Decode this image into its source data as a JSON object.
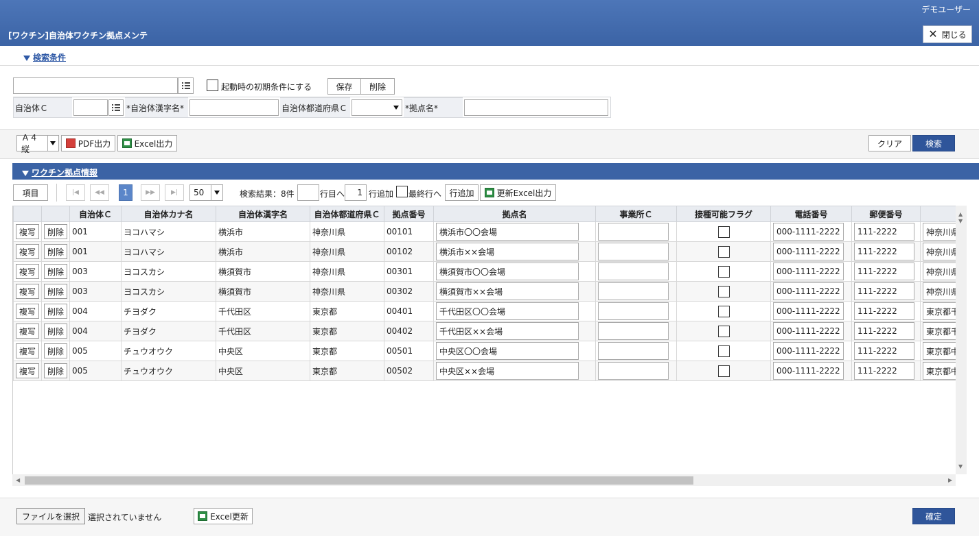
{
  "header": {
    "user": "デモユーザー",
    "title": "[ワクチン]自治体ワクチン拠点メンテ",
    "close_label": "閉じる"
  },
  "search": {
    "section_title": "検索条件",
    "saved_condition_value": "",
    "startup_checkbox_label": "起動時の初期条件にする",
    "save_label": "保存",
    "delete_label": "削除",
    "fields": [
      {
        "label": "自治体Ｃ",
        "value": ""
      },
      {
        "label": "*自治体漢字名*",
        "value": ""
      },
      {
        "label": "自治体都道府県Ｃ",
        "value": ""
      },
      {
        "label": "*拠点名*",
        "value": ""
      }
    ]
  },
  "toolbar": {
    "paper_size": "Ａ４縦",
    "pdf_label": "PDF出力",
    "excel_label": "Excel出力",
    "clear_label": "クリア",
    "search_label": "検索"
  },
  "results": {
    "section_title": "ワクチン拠点情報",
    "items_label": "項目",
    "current_page": "1",
    "page_size": "50",
    "result_count": "検索結果：8件",
    "goto_value": "",
    "goto_suffix": "行目へ",
    "add_count": "1",
    "add_suffix": "行追加",
    "last_row_label": "最終行へ",
    "add_row_label": "行追加",
    "update_excel_label": "更新Excel出力",
    "columns": [
      "",
      "",
      "自治体Ｃ",
      "自治体カナ名",
      "自治体漢字名",
      "自治体都道府県Ｃ",
      "拠点番号",
      "拠点名",
      "事業所Ｃ",
      "接種可能フラグ",
      "電話番号",
      "郵便番号",
      ""
    ],
    "copy_label": "複写",
    "row_delete_label": "削除",
    "rows": [
      {
        "code": "001",
        "kana": "ヨコハマシ",
        "kanji": "横浜市",
        "pref": "神奈川県",
        "no": "00101",
        "name": "横浜市〇〇会場",
        "office": "",
        "tel": "000-1111-2222",
        "zip": "111-2222",
        "addr": "神奈川県"
      },
      {
        "code": "001",
        "kana": "ヨコハマシ",
        "kanji": "横浜市",
        "pref": "神奈川県",
        "no": "00102",
        "name": "横浜市××会場",
        "office": "",
        "tel": "000-1111-2222",
        "zip": "111-2222",
        "addr": "神奈川県"
      },
      {
        "code": "003",
        "kana": "ヨコスカシ",
        "kanji": "横須賀市",
        "pref": "神奈川県",
        "no": "00301",
        "name": "横須賀市〇〇会場",
        "office": "",
        "tel": "000-1111-2222",
        "zip": "111-2222",
        "addr": "神奈川県"
      },
      {
        "code": "003",
        "kana": "ヨコスカシ",
        "kanji": "横須賀市",
        "pref": "神奈川県",
        "no": "00302",
        "name": "横須賀市××会場",
        "office": "",
        "tel": "000-1111-2222",
        "zip": "111-2222",
        "addr": "神奈川県"
      },
      {
        "code": "004",
        "kana": "チヨダク",
        "kanji": "千代田区",
        "pref": "東京都",
        "no": "00401",
        "name": "千代田区〇〇会場",
        "office": "",
        "tel": "000-1111-2222",
        "zip": "111-2222",
        "addr": "東京都千"
      },
      {
        "code": "004",
        "kana": "チヨダク",
        "kanji": "千代田区",
        "pref": "東京都",
        "no": "00402",
        "name": "千代田区××会場",
        "office": "",
        "tel": "000-1111-2222",
        "zip": "111-2222",
        "addr": "東京都千"
      },
      {
        "code": "005",
        "kana": "チュウオウク",
        "kanji": "中央区",
        "pref": "東京都",
        "no": "00501",
        "name": "中央区〇〇会場",
        "office": "",
        "tel": "000-1111-2222",
        "zip": "111-2222",
        "addr": "東京都中"
      },
      {
        "code": "005",
        "kana": "チュウオウク",
        "kanji": "中央区",
        "pref": "東京都",
        "no": "00502",
        "name": "中央区××会場",
        "office": "",
        "tel": "000-1111-2222",
        "zip": "111-2222",
        "addr": "東京都中"
      }
    ]
  },
  "footer": {
    "choose_file_label": "ファイルを選択",
    "no_file_label": "選択されていません",
    "excel_update_label": "Excel更新",
    "confirm_label": "確定"
  }
}
